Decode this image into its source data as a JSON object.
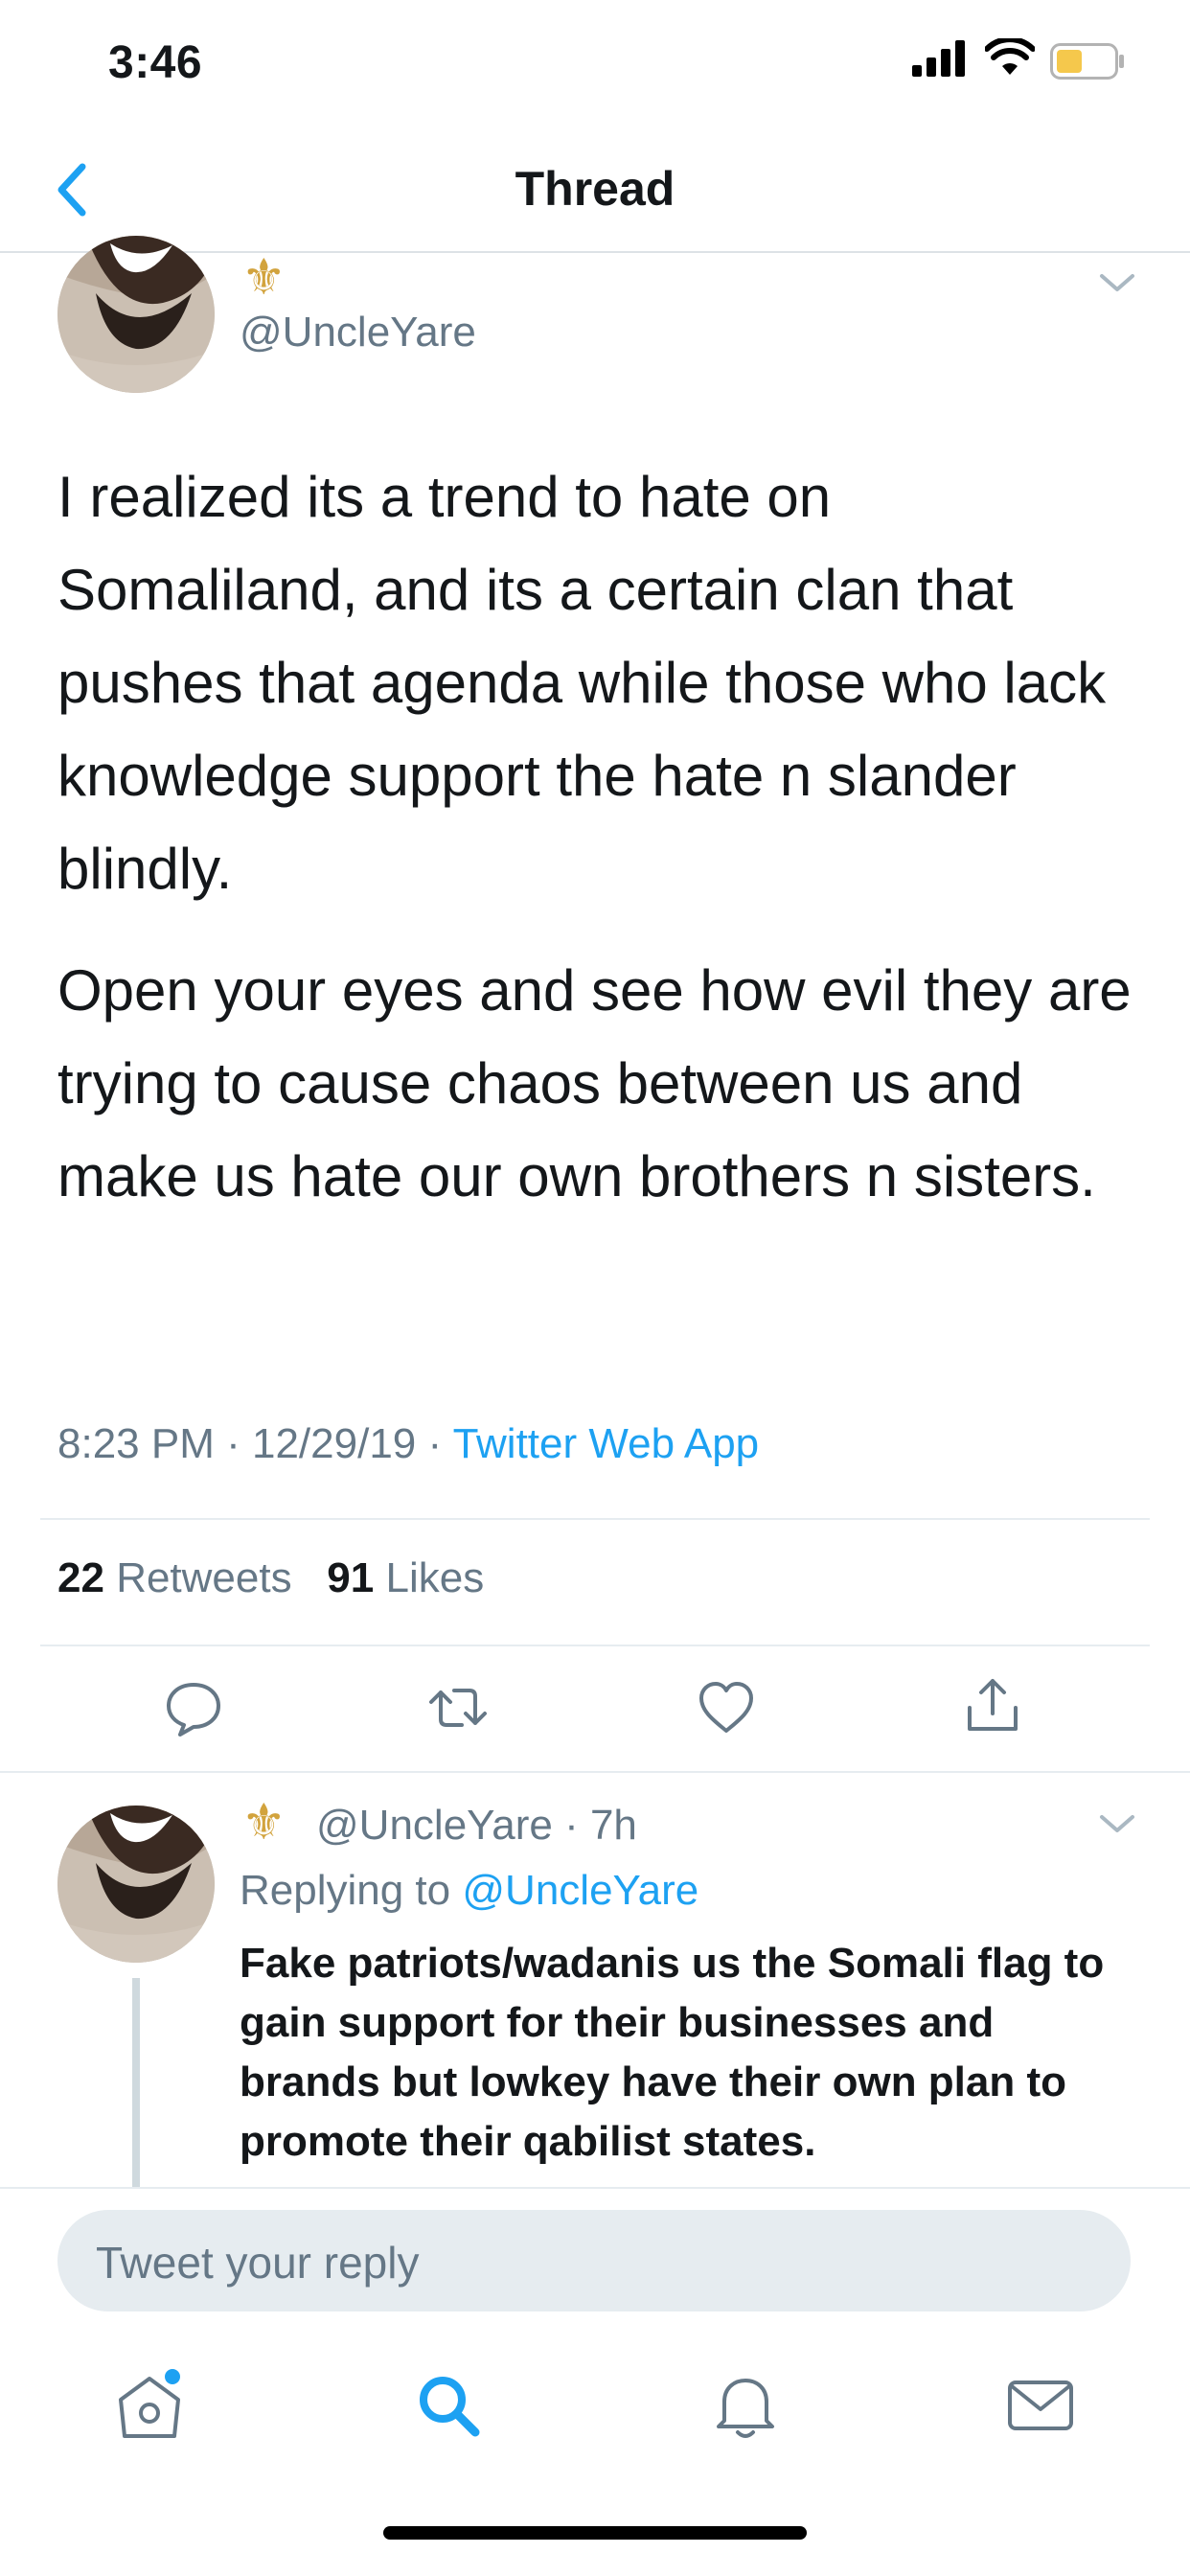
{
  "status_bar": {
    "time": "3:46"
  },
  "nav": {
    "title": "Thread"
  },
  "main_tweet": {
    "handle": "@UncleYare",
    "paragraph_1": "I realized its a trend to hate on Somaliland, and its a certain clan that pushes that agenda while those who lack knowledge support the hate n slander blindly.",
    "paragraph_2": "Open your eyes and see how evil they are trying to cause chaos between us and make us hate our own brothers n sisters.",
    "time": "8:23 PM",
    "date": "12/29/19",
    "source": "Twitter Web App",
    "retweets_count": "22",
    "retweets_label": "Retweets",
    "likes_count": "91",
    "likes_label": "Likes"
  },
  "reply_tweet": {
    "handle": "@UncleYare",
    "age": "7h",
    "replying_label": "Replying to",
    "replying_handle": "@UncleYare",
    "text": "Fake patriots/wadanis us the Somali flag to gain support for their businesses and brands but lowkey have their own plan to promote their qabilist states."
  },
  "composer": {
    "placeholder": "Tweet your reply"
  },
  "colors": {
    "accent": "#1da1f2",
    "secondary_text": "#657786",
    "divider": "#e6ecf0",
    "battery": "#f5c84c"
  }
}
